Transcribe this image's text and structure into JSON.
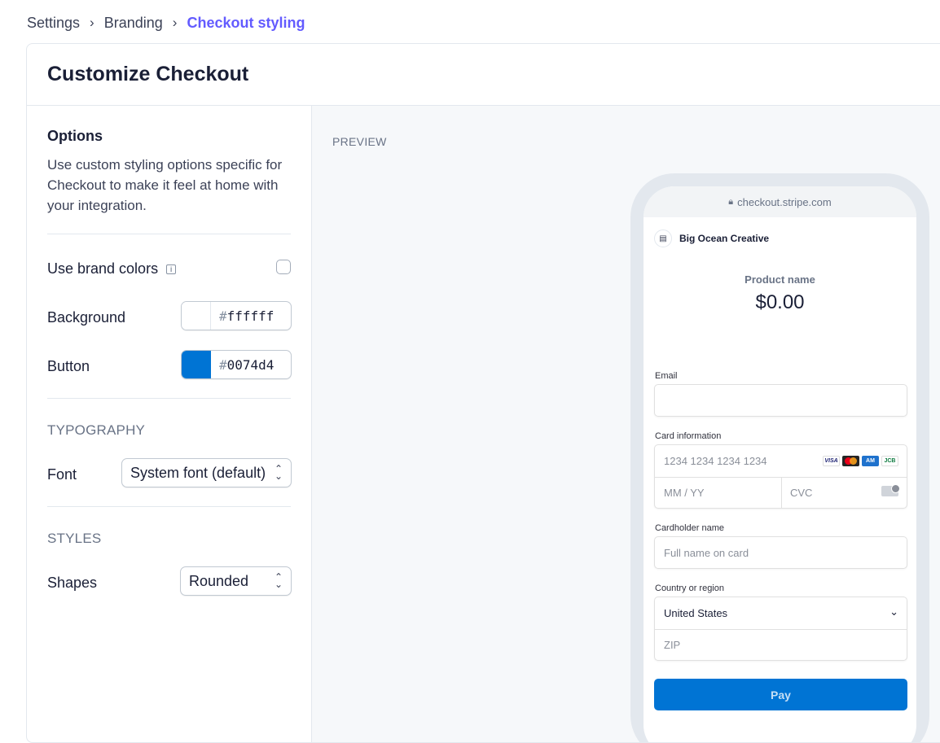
{
  "breadcrumb": {
    "items": [
      "Settings",
      "Branding",
      "Checkout styling"
    ],
    "separator": ">"
  },
  "page": {
    "title": "Customize Checkout"
  },
  "options": {
    "title": "Options",
    "description": "Use custom styling options specific for Checkout to make it feel at home with your integration.",
    "use_brand_colors_label": "Use brand colors",
    "use_brand_colors_checked": false,
    "background_label": "Background",
    "background_color": "ffffff",
    "button_label": "Button",
    "button_color": "0074d4",
    "hash": "#"
  },
  "typography": {
    "title": "TYPOGRAPHY",
    "font_label": "Font",
    "font_value": "System font (default)"
  },
  "styles": {
    "title": "STYLES",
    "shapes_label": "Shapes",
    "shapes_value": "Rounded"
  },
  "preview": {
    "label": "PREVIEW",
    "url": "checkout.stripe.com",
    "merchant_name": "Big Ocean Creative",
    "product_name": "Product name",
    "price": "$0.00",
    "email_label": "Email",
    "card_label": "Card information",
    "card_number_placeholder": "1234 1234 1234 1234",
    "expiry_placeholder": "MM / YY",
    "cvc_placeholder": "CVC",
    "card_brands": [
      "VISA",
      "mastercard",
      "amex",
      "jcb"
    ],
    "cardholder_label": "Cardholder name",
    "cardholder_placeholder": "Full name on card",
    "country_label": "Country or region",
    "country_value": "United States",
    "zip_placeholder": "ZIP",
    "pay_label": "Pay"
  },
  "colors": {
    "accent": "#635bff",
    "button": "#0074d4",
    "background": "#ffffff"
  }
}
